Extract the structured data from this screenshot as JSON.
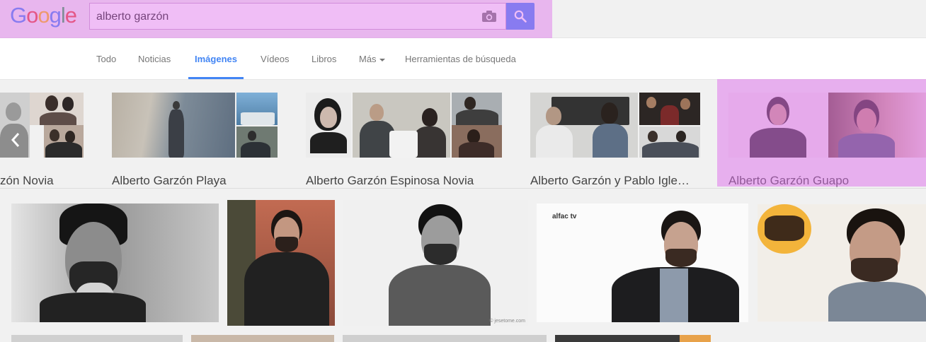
{
  "logo": {
    "letters": [
      "G",
      "o",
      "o",
      "g",
      "l",
      "e"
    ],
    "colors": [
      "#4285f4",
      "#ea4335",
      "#fbbc05",
      "#4285f4",
      "#34a853",
      "#ea4335"
    ]
  },
  "search": {
    "query": "alberto garzón",
    "camera_icon": "camera-icon",
    "button_icon": "search-icon"
  },
  "tabs": [
    {
      "label": "Todo",
      "active": false
    },
    {
      "label": "Noticias",
      "active": false
    },
    {
      "label": "Imágenes",
      "active": true
    },
    {
      "label": "Vídeos",
      "active": false
    },
    {
      "label": "Libros",
      "active": false
    },
    {
      "label": "Más",
      "active": false,
      "dropdown": true
    },
    {
      "label": "Herramientas de búsqueda",
      "active": false
    }
  ],
  "related": [
    {
      "label": "zón Novia"
    },
    {
      "label": "Alberto Garzón Playa"
    },
    {
      "label": "Alberto Garzón Espinosa Novia"
    },
    {
      "label": "Alberto Garzón y Pablo Igle…"
    },
    {
      "label": "Alberto Garzón Guapo"
    }
  ],
  "results": {
    "watermark_3": "© jesetome.com",
    "logo_4": "alfac tv"
  },
  "colors": {
    "accent": "#4285f4",
    "highlight": "#de6eeb"
  }
}
